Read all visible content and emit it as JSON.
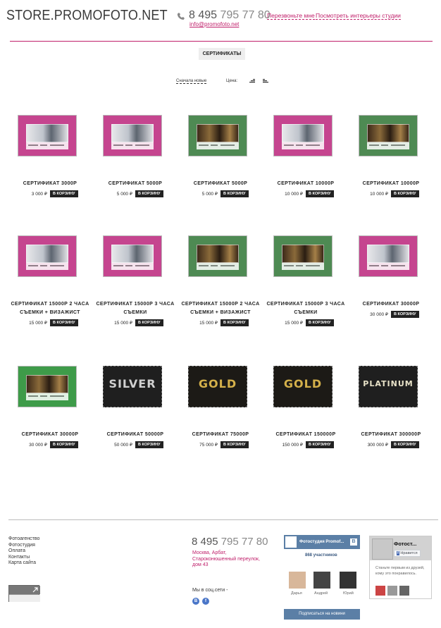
{
  "header": {
    "logo": "STORE.PROMOFOTO.NET",
    "phone_prefix": "8 495",
    "phone_number": "795 77 80",
    "email": "info@promofoto.net",
    "link_callback": "Перезвоньте мне",
    "link_interiors": "Посмотреть интерьеры студии"
  },
  "category_button": "СЕРТИФИКАТЫ",
  "sort": {
    "label": "Сначала новые",
    "price_label": "Цена:"
  },
  "cart_label": "В КОРЗИНУ",
  "products": [
    {
      "title_lines": [
        "СЕРТИФИКАТ 3000Р"
      ],
      "price": "3 000 ₽",
      "style": "pink"
    },
    {
      "title_lines": [
        "СЕРТИФИКАТ 5000Р"
      ],
      "price": "5 000 ₽",
      "style": "pink"
    },
    {
      "title_lines": [
        "СЕРТИФИКАТ 5000Р"
      ],
      "price": "5 000 ₽",
      "style": "green"
    },
    {
      "title_lines": [
        "СЕРТИФИКАТ 10000Р"
      ],
      "price": "10 000 ₽",
      "style": "pink"
    },
    {
      "title_lines": [
        "СЕРТИФИКАТ 10000Р"
      ],
      "price": "10 000 ₽",
      "style": "green"
    },
    {
      "title_lines": [
        "СЕРТИФИКАТ 15000Р 2 ЧАСА",
        "СЪЕМКИ + ВИЗАЖИСТ"
      ],
      "price": "15 000 ₽",
      "style": "pink"
    },
    {
      "title_lines": [
        "СЕРТИФИКАТ 15000Р 3 ЧАСА",
        "СЪЕМКИ"
      ],
      "price": "15 000 ₽",
      "style": "pink"
    },
    {
      "title_lines": [
        "СЕРТИФИКАТ 15000Р 2 ЧАСА",
        "СЪЕМКИ + ВИЗАЖИСТ"
      ],
      "price": "15 000 ₽",
      "style": "green"
    },
    {
      "title_lines": [
        "СЕРТИФИКАТ 15000Р 3 ЧАСА",
        "СЪЕМКИ"
      ],
      "price": "15 000 ₽",
      "style": "green"
    },
    {
      "title_lines": [
        "СЕРТИФИКАТ 30000Р"
      ],
      "price": "30 000 ₽",
      "style": "pink"
    },
    {
      "title_lines": [
        "СЕРТИФИКАТ 30000Р"
      ],
      "price": "30 000 ₽",
      "style": "green2"
    },
    {
      "title_lines": [
        "СЕРТИФИКАТ 50000Р"
      ],
      "price": "50 000 ₽",
      "style": "silver",
      "badge": "SILVER"
    },
    {
      "title_lines": [
        "СЕРТИФИКАТ 75000Р"
      ],
      "price": "75 000 ₽",
      "style": "gold",
      "badge": "GOLD"
    },
    {
      "title_lines": [
        "СЕРТИФИКАТ 150000Р"
      ],
      "price": "150 000 ₽",
      "style": "gold",
      "badge": "GOLD"
    },
    {
      "title_lines": [
        "СЕРТИФИКАТ 300000Р"
      ],
      "price": "300 000 ₽",
      "style": "platinum",
      "badge": "PLATINUM"
    }
  ],
  "footer": {
    "menu": [
      "Фотоагенство",
      "Фотостудия",
      "Оплата",
      "Контакты",
      "Карта сайта"
    ],
    "phone_prefix": "8 495",
    "phone_number": "795 77 80",
    "address": "Москва, Арбат, Староконюшенный переулок, дом 43",
    "social_label": "Мы в соц.сети -",
    "vk": {
      "title": "Фотостудия Promof...",
      "members": "868 участников",
      "people": [
        "Дарья",
        "Андрей",
        "Юрий"
      ],
      "subscribe": "Подписаться на новини"
    },
    "fb": {
      "title": "Фотост...",
      "like": "Нравится",
      "text": "Станьте первым из друзей, кому это понравилось."
    }
  },
  "colors": {
    "accent": "#c0206b",
    "pink": "#c5458f",
    "green": "#4e8a53",
    "dark": "#222222"
  }
}
